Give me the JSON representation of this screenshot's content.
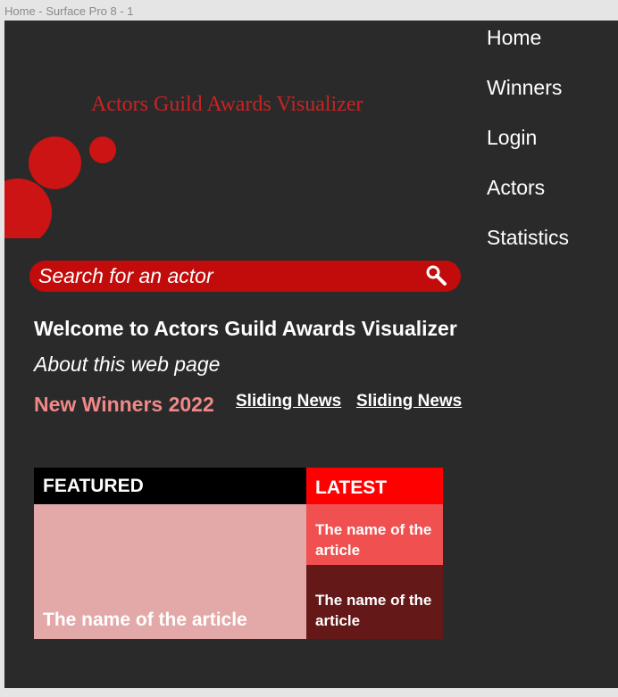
{
  "frame_label": "Home - Surface Pro 8 - 1",
  "nav": {
    "items": [
      {
        "label": "Home"
      },
      {
        "label": "Winners"
      },
      {
        "label": "Login"
      },
      {
        "label": "Actors"
      },
      {
        "label": "Statistics"
      }
    ]
  },
  "header": {
    "title": "Actors Guild Awards Visualizer"
  },
  "search": {
    "placeholder": "Search for an actor",
    "value": ""
  },
  "intro": {
    "welcome": "Welcome to Actors Guild Awards Visualizer",
    "about": "About this web page"
  },
  "news": {
    "title": "New Winners 2022",
    "links": [
      {
        "label": "Sliding News"
      },
      {
        "label": "Sliding News"
      }
    ]
  },
  "featured": {
    "header": "FEATURED",
    "article": "The name  of the article"
  },
  "latest": {
    "header": "LATEST",
    "items": [
      {
        "title": "The name of the article"
      },
      {
        "title": "The name of the article"
      }
    ]
  },
  "colors": {
    "background": "#2a2a2a",
    "accent_red": "#c20b0b",
    "title_red": "#cc2222",
    "featured_pink": "#e3a9a8",
    "latest_red": "#ff0000",
    "latest_item_light": "#f05050",
    "latest_item_dark": "#651818",
    "news_pink": "#f08888"
  },
  "icons": {
    "search": "search-icon"
  }
}
